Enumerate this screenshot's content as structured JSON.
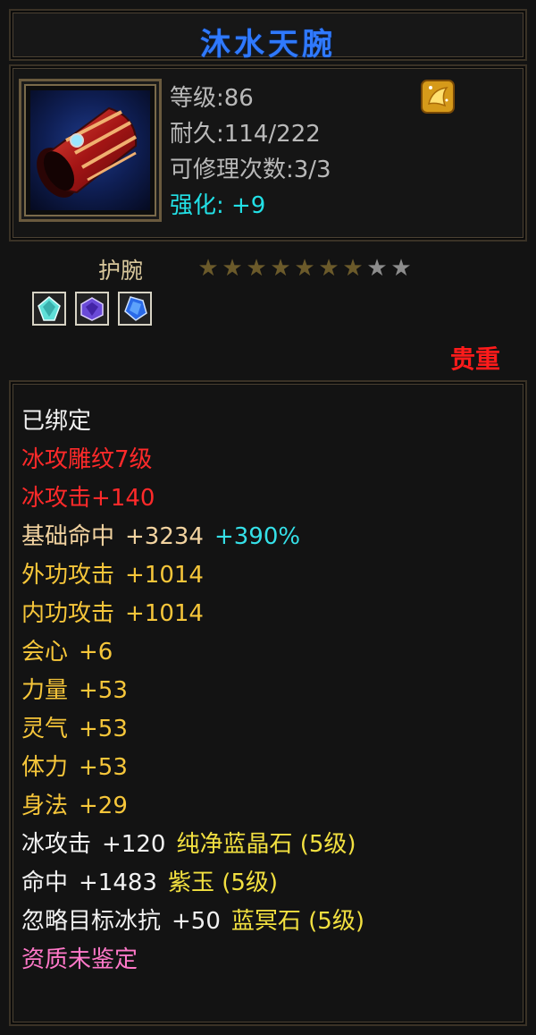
{
  "item": {
    "name": "沐水天腕",
    "stats": [
      "等级:86",
      "耐久:114/222",
      "可修理次数:3/3"
    ],
    "enhance": "强化: +9",
    "type": "护腕",
    "stars_total": 9,
    "stars_filled": 7,
    "rarity": "贵重"
  },
  "colors": {
    "title": "#2f79ff",
    "rarity": "#ff1b1b",
    "enhance": "#22e0e6"
  },
  "attributes": {
    "bound": "已绑定",
    "engrave": "冰攻雕纹7级",
    "ice_attack": "冰攻击+140",
    "hit_label": "基础命中",
    "hit_value": "+3234",
    "hit_pct": "+390%",
    "outer_label": "外功攻击",
    "outer_value": "+1014",
    "inner_label": "内功攻击",
    "inner_value": "+1014",
    "crit_label": "会心",
    "crit_value": "+6",
    "str_label": "力量",
    "str_value": "+53",
    "spirit_label": "灵气",
    "spirit_value": "+53",
    "vit_label": "体力",
    "vit_value": "+53",
    "agi_label": "身法",
    "agi_value": "+29",
    "gem1_stat": "冰攻击",
    "gem1_value": "+120",
    "gem1_name": "纯净蓝晶石 (5级)",
    "gem2_stat": "命中",
    "gem2_value": "+1483",
    "gem2_name": "紫玉 (5级)",
    "gem3_stat": "忽略目标冰抗",
    "gem3_value": "+50",
    "gem3_name": "蓝冥石 (5级)",
    "quality": "资质未鉴定"
  },
  "sockets": [
    "aqua-gem-icon",
    "purple-gem-icon",
    "blue-gem-icon"
  ]
}
